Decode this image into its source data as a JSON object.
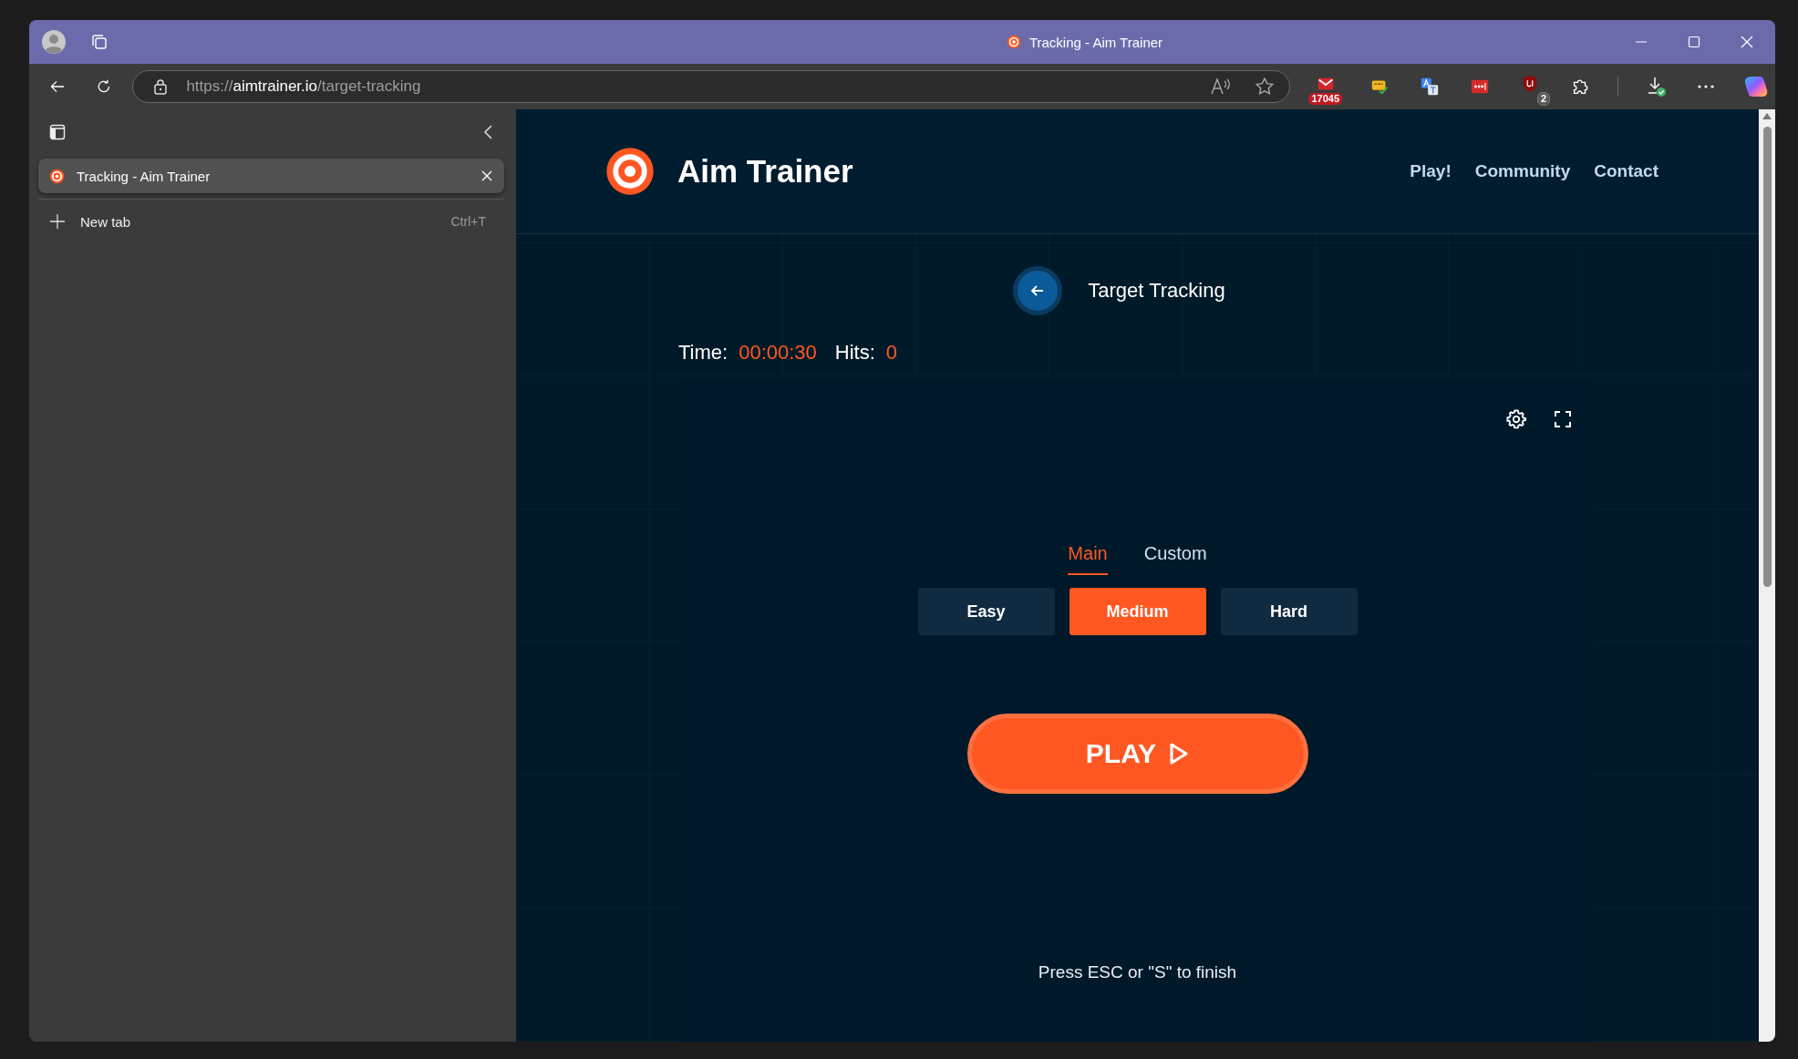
{
  "title_bar": {
    "title": "Tracking - Aim Trainer"
  },
  "toolbar": {
    "url": {
      "scheme": "https://",
      "host": "aimtrainer.io",
      "path": "/target-tracking"
    },
    "extensions": [
      {
        "kind": "mail",
        "badge": "17045"
      },
      {
        "kind": "css"
      },
      {
        "kind": "translate"
      },
      {
        "kind": "dots"
      },
      {
        "kind": "shield",
        "badge": "2"
      },
      {
        "kind": "puzzle"
      }
    ]
  },
  "sidebar": {
    "tabs": [
      {
        "title": "Tracking - Aim Trainer",
        "selected": true
      }
    ],
    "new_tab": {
      "label": "New tab",
      "shortcut": "Ctrl+T"
    }
  },
  "page": {
    "brand": "Aim Trainer",
    "nav": [
      "Play!",
      "Community",
      "Contact"
    ],
    "heading": "Target Tracking",
    "stats": [
      {
        "label": "Time:",
        "value": "00:00:30"
      },
      {
        "label": "Hits:",
        "value": "0"
      }
    ],
    "mode_tabs": [
      {
        "label": "Main",
        "selected": true
      },
      {
        "label": "Custom",
        "selected": false
      }
    ],
    "difficulties": [
      {
        "label": "Easy",
        "selected": false
      },
      {
        "label": "Medium",
        "selected": true
      },
      {
        "label": "Hard",
        "selected": false
      }
    ],
    "play": "PLAY",
    "hint": "Press ESC or \"S\" to finish"
  }
}
